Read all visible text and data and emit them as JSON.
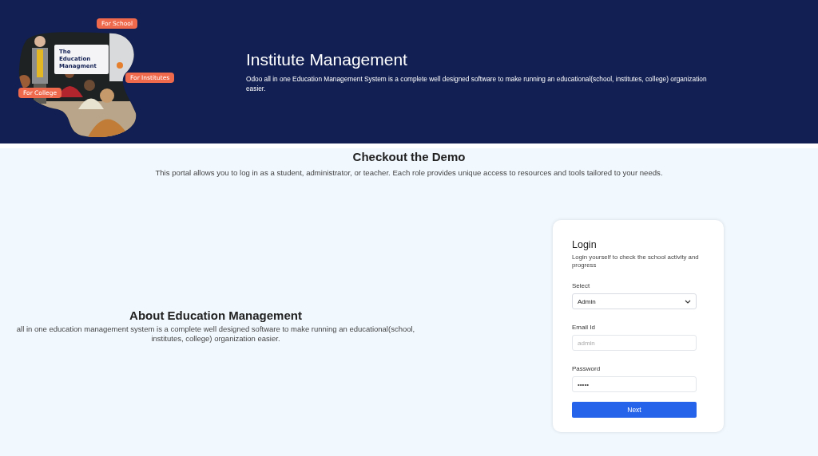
{
  "hero": {
    "image": {
      "kind": "picture",
      "caption": "The Education Managment",
      "tags": [
        {
          "label": "For School"
        },
        {
          "label": "For Institutes"
        },
        {
          "label": "For College"
        }
      ]
    },
    "title": "Institute Management",
    "description": "Odoo all in one Education Management System is a complete well designed software to make running an educational(school, institutes, college) organization easier."
  },
  "demo": {
    "title": "Checkout the Demo",
    "description": "This portal allows you to log in as a student, administrator, or teacher. Each role provides unique access to resources and tools tailored to your needs."
  },
  "about": {
    "title": "About Education Management",
    "description": "all in one education management system is a complete well designed software to make running an educational(school, institutes, college) organization easier."
  },
  "login": {
    "title": "Login",
    "subtitle": "Login yourself to check the school activity and progress",
    "fields": [
      {
        "kind": "select",
        "label": "Select",
        "value": "Admin"
      },
      {
        "kind": "input",
        "label": "Email Id",
        "placeholder": "admin"
      },
      {
        "kind": "input",
        "label": "Password",
        "value": "•••••"
      }
    ],
    "button": "Next"
  }
}
